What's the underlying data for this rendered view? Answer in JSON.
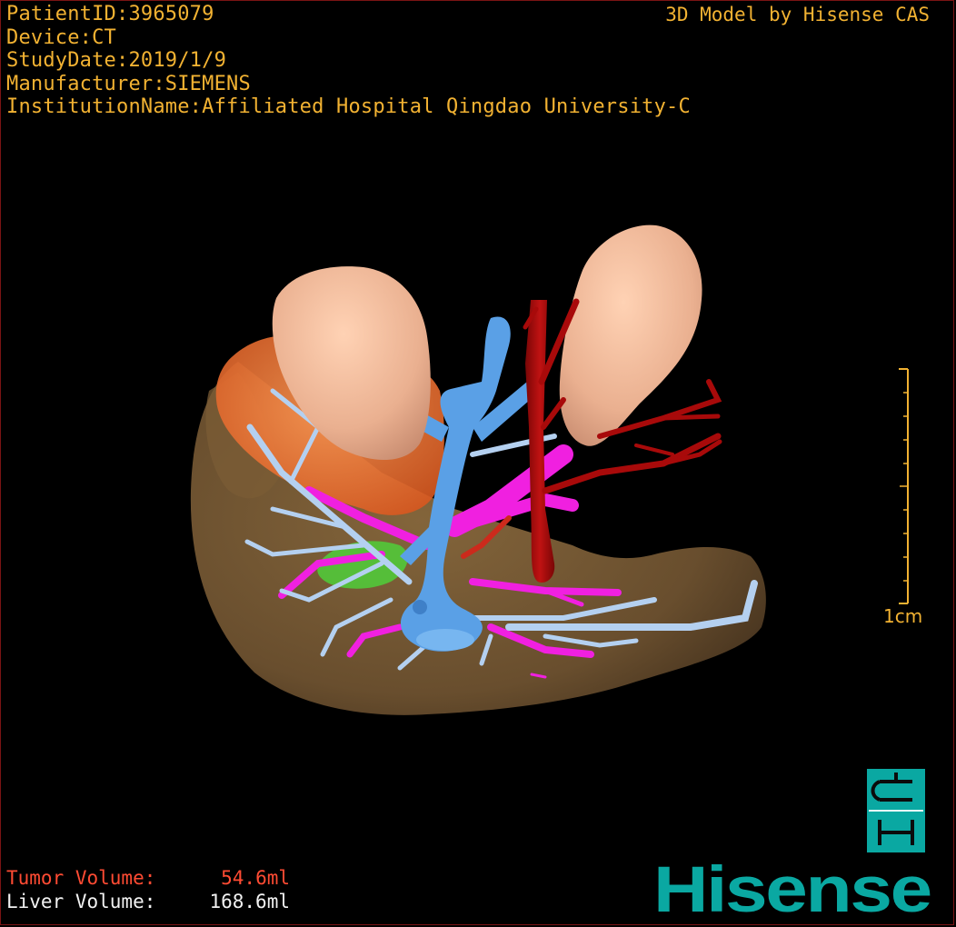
{
  "header": {
    "patient_id": "PatientID:3965079",
    "device": "Device:CT",
    "study_date": "StudyDate:2019/1/9",
    "manufacturer": "Manufacturer:SIEMENS",
    "institution": "InstitutionName:Affiliated Hospital Qingdao University-C"
  },
  "credit": "3D Model by Hisense CAS",
  "scale_bar": {
    "label": "1cm"
  },
  "volumes": {
    "tumor": {
      "label": "Tumor Volume:",
      "value": "54.6ml"
    },
    "liver": {
      "label": "Liver Volume:",
      "value": "168.6ml"
    }
  },
  "brand": {
    "logo_icon": "hisense-dh-logo-icon",
    "wordmark": "Hisense",
    "color": "#0aa8a2"
  },
  "colors": {
    "overlay_text": "#f2b232",
    "tumor_text": "#ff4b33",
    "liver": "#6e5230",
    "kidney": "#f0b898",
    "portal_vein": "#5aa0e6",
    "hepatic_vein": "#b4d0f0",
    "artery": "#b00d0d",
    "bile_magenta": "#f020e0",
    "tumor_orange": "#f06a2a",
    "tumor_green": "#4fcf3a"
  }
}
